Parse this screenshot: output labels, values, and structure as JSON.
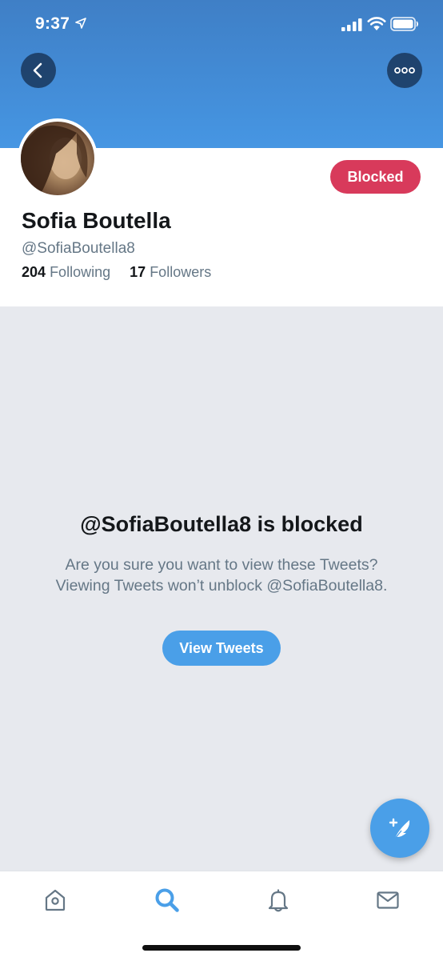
{
  "status_bar": {
    "time": "9:37"
  },
  "profile": {
    "display_name": "Sofia Boutella",
    "handle": "@SofiaBoutella8",
    "following_count": "204",
    "following_label": "Following",
    "followers_count": "17",
    "followers_label": "Followers",
    "blocked_label": "Blocked"
  },
  "blocked_notice": {
    "title": "@SofiaBoutella8 is blocked",
    "message": "Are you sure you want to view these Tweets? Viewing Tweets won’t unblock @SofiaBoutella8.",
    "view_button": "View Tweets"
  },
  "tabbar": {
    "items": [
      {
        "icon": "home-icon",
        "active": false
      },
      {
        "icon": "search-icon",
        "active": true
      },
      {
        "icon": "bell-icon",
        "active": false
      },
      {
        "icon": "mail-icon",
        "active": false
      }
    ]
  },
  "colors": {
    "accent": "#4a9fe8",
    "blocked": "#d83a5b",
    "muted_text": "#657786",
    "background": "#e7e9ee"
  }
}
